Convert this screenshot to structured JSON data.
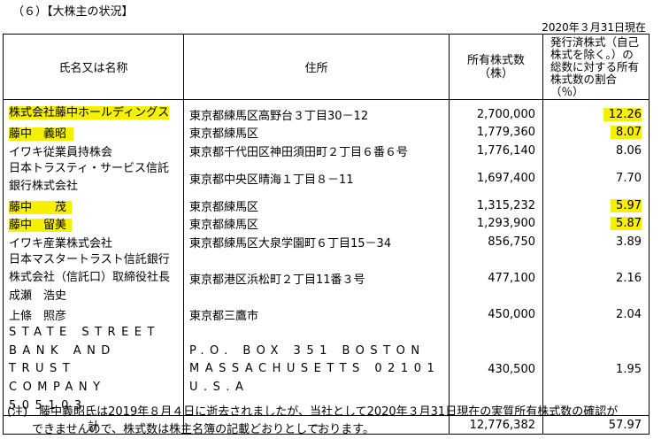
{
  "heading": "（６）【大株主の状況】",
  "as_of": "2020年３月31日現在",
  "columns": {
    "name": "氏名又は名称",
    "address": "住所",
    "shares": "所有株式数（株）",
    "ratio": "発行済株式（自己株式を除く。）の総数に対する所有株式数の割合（％）"
  },
  "rows": [
    {
      "name": "株式会社藤中ホールディングス",
      "address": "東京都練馬区高野台３丁目30－12",
      "shares": "2,700,000",
      "ratio": "12.26"
    },
    {
      "name": "藤中　義昭",
      "address": "東京都練馬区",
      "shares": "1,779,360",
      "ratio": "8.07"
    },
    {
      "name": "イワキ従業員持株会",
      "address": "東京都千代田区神田須田町２丁目６番６号",
      "shares": "1,776,140",
      "ratio": "8.06"
    },
    {
      "name": "日本トラスティ・サービス信託銀行株式会社",
      "address": "東京都中央区晴海１丁目８－11",
      "shares": "1,697,400",
      "ratio": "7.70"
    },
    {
      "name": "藤中　　茂",
      "address": "東京都練馬区",
      "shares": "1,315,232",
      "ratio": "5.97"
    },
    {
      "name": "藤中　留美",
      "address": "東京都練馬区",
      "shares": "1,293,900",
      "ratio": "5.87"
    },
    {
      "name": "イワキ産業株式会社",
      "address": "東京都練馬区大泉学園町６丁目15－34",
      "shares": "856,750",
      "ratio": "3.89"
    },
    {
      "name": "日本マスタートラスト信託銀行株式会社（信託口）取締役社長　成瀬　浩史",
      "address": "東京都港区浜松町２丁目11番３号",
      "shares": "477,100",
      "ratio": "2.16"
    },
    {
      "name": "上條　照彦",
      "address": "東京都三鷹市",
      "shares": "450,000",
      "ratio": "2.04"
    },
    {
      "name": "STATE STREET BANK AND TRUST COMPANY 505103",
      "address": "P.O. BOX 351 BOSTON MASSACHUSETTS 02101 U.S.A",
      "shares": "430,500",
      "ratio": "1.95"
    }
  ],
  "total": {
    "label": "計",
    "address": "－",
    "shares": "12,776,382",
    "ratio": "57.97"
  },
  "note_line1": "(注)　藤中義昭氏は2019年８月４日に逝去されましたが、当社として2020年３月31日現在の実質所有株式数の確認が",
  "note_line2": "できませんので、株式数は株主名簿の記載どおりとしております。",
  "highlight_color": "#f6f000"
}
